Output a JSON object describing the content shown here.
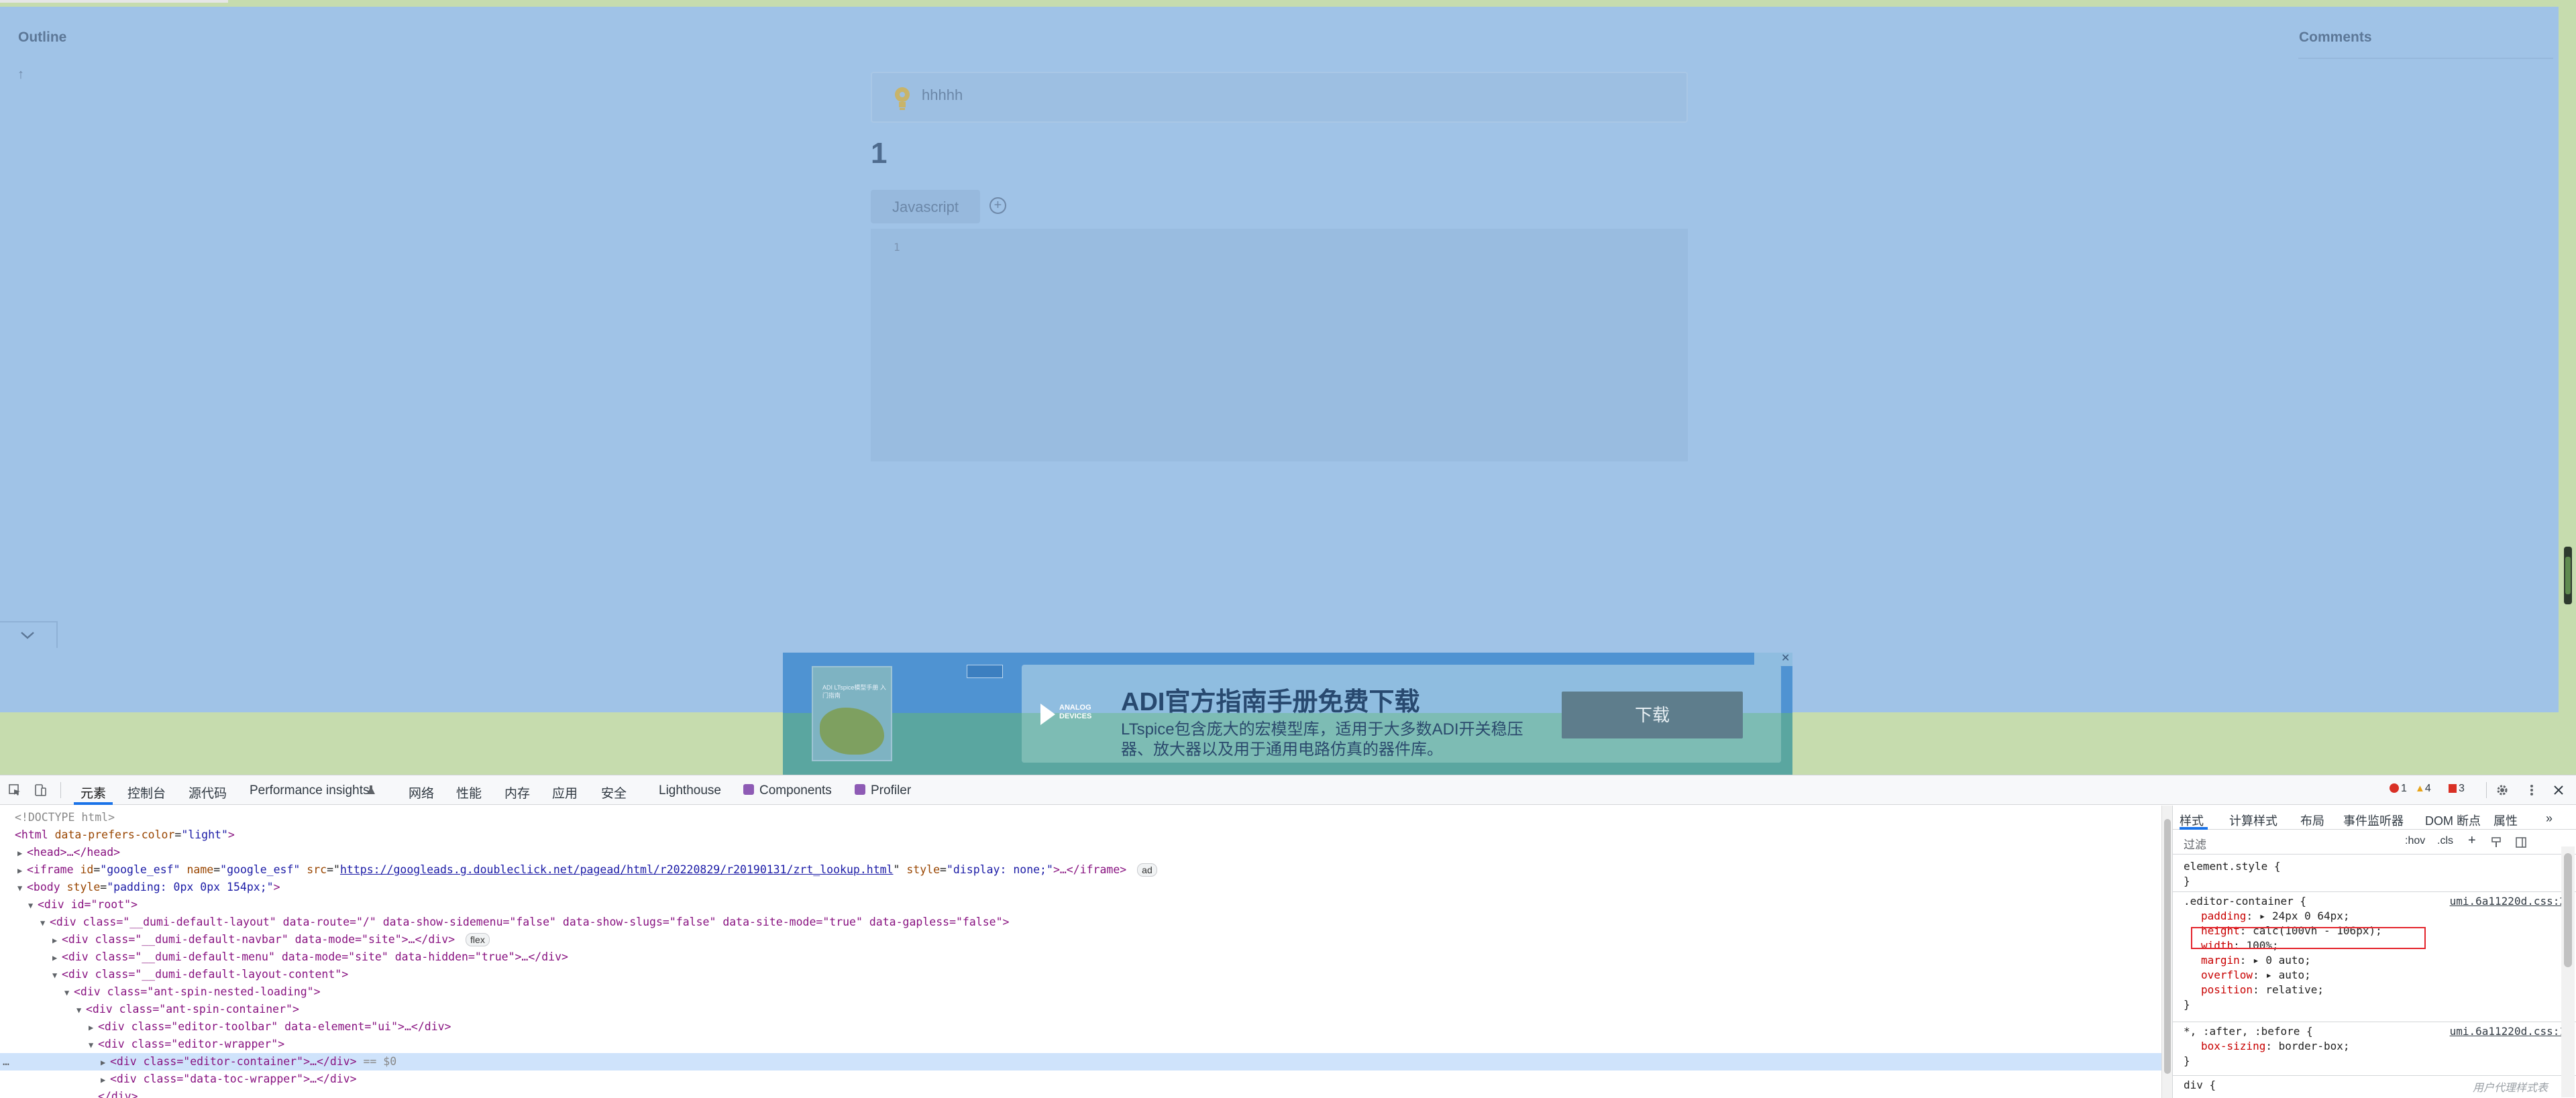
{
  "page": {
    "outline_title": "Outline",
    "outline_arrow": "↑",
    "comments_title": "Comments",
    "callout_text": "hhhhh",
    "heading": "1",
    "code_tab_label": "Javascript",
    "add_tab_symbol": "+",
    "code_line_number": "1"
  },
  "ad": {
    "book_title": "ADI LTspice模型手册 入门指南",
    "brand_line1": "ANALOG",
    "brand_line2": "DEVICES",
    "headline": "ADI官方指南手册免费下载",
    "description": "LTspice包含庞大的宏模型库，适用于大多数ADI开关稳压器、放大器以及用于通用电路仿真的器件库。",
    "download_label": "下载",
    "close_symbol": "✕"
  },
  "devtools": {
    "tabs": [
      "元素",
      "控制台",
      "源代码",
      "Performance insights",
      "网络",
      "性能",
      "内存",
      "应用",
      "安全",
      "Lighthouse",
      "Components",
      "Profiler"
    ],
    "errors_count": "1",
    "warnings_count": "4",
    "issues_count": "3",
    "dom": {
      "doctype": "<!DOCTYPE html>",
      "html_open": "<html",
      "html_attr": "data-prefers-color",
      "html_val": "\"light\"",
      "head": "<head>…</head>",
      "iframe_tag": "<iframe",
      "iframe_id_attr": "id",
      "iframe_id_val": "\"google_esf\"",
      "iframe_name_attr": "name",
      "iframe_name_val": "\"google_esf\"",
      "iframe_src_attr": "src",
      "iframe_src_val": "https://googleads.g.doubleclick.net/pagead/html/r20220829/r20190131/zrt_lookup.html",
      "iframe_style_attr": "style",
      "iframe_style_val": "\"display: none;\"",
      "iframe_rest": ">…</iframe>",
      "iframe_badge": "ad",
      "body_tag": "<body",
      "body_style_attr": "style",
      "body_style_val": "\"padding: 0px 0px 154px;\"",
      "root_line": "<div id=\"root\">",
      "layout_line": "<div class=\"__dumi-default-layout\" data-route=\"/\" data-show-sidemenu=\"false\" data-show-slugs=\"false\" data-site-mode=\"true\" data-gapless=\"false\">",
      "navbar_line": "<div class=\"__dumi-default-navbar\" data-mode=\"site\">…</div>",
      "navbar_badge": "flex",
      "menu_line": "<div class=\"__dumi-default-menu\" data-mode=\"site\" data-hidden=\"true\">…</div>",
      "content_line": "<div class=\"__dumi-default-layout-content\">",
      "spin_nested_line": "<div class=\"ant-spin-nested-loading\">",
      "spin_container_line": "<div class=\"ant-spin-container\">",
      "toolbar_line": "<div class=\"editor-toolbar\" data-element=\"ui\">…</div>",
      "wrapper_line": "<div class=\"editor-wrapper\">",
      "container_line": "<div class=\"editor-container\">…</div>",
      "container_marker": "== $0",
      "toc_line": "<div class=\"data-toc-wrapper\">…</div>",
      "close_div": "</div>",
      "ellipsis": "…"
    },
    "styles": {
      "tabs": [
        "样式",
        "计算样式",
        "布局",
        "事件监听器",
        "DOM 断点",
        "属性"
      ],
      "more_symbol": "»",
      "filter_placeholder": "过滤",
      "hov": ":hov",
      "cls": ".cls",
      "element_style": "element.style {",
      "close_brace": "}",
      "rule1_selector": ".editor-container {",
      "rule1_source": "umi.6a11220d.css:2",
      "rule1_props": [
        {
          "name": "padding",
          "value": "▸ 24px 0 64px;"
        },
        {
          "name": "height",
          "value": "calc(100vh - 106px);"
        },
        {
          "name": "width",
          "value": "100%;"
        },
        {
          "name": "margin",
          "value": "▸ 0 auto;"
        },
        {
          "name": "overflow",
          "value": "▸ auto;"
        },
        {
          "name": "position",
          "value": "relative;"
        }
      ],
      "rule2_selector": "*, :after, :before {",
      "rule2_source": "umi.6a11220d.css:1",
      "rule2_prop_name": "box-sizing",
      "rule2_prop_value": "border-box;",
      "rule3_selector": "div {",
      "user_agent_label": "用户代理样式表"
    }
  }
}
